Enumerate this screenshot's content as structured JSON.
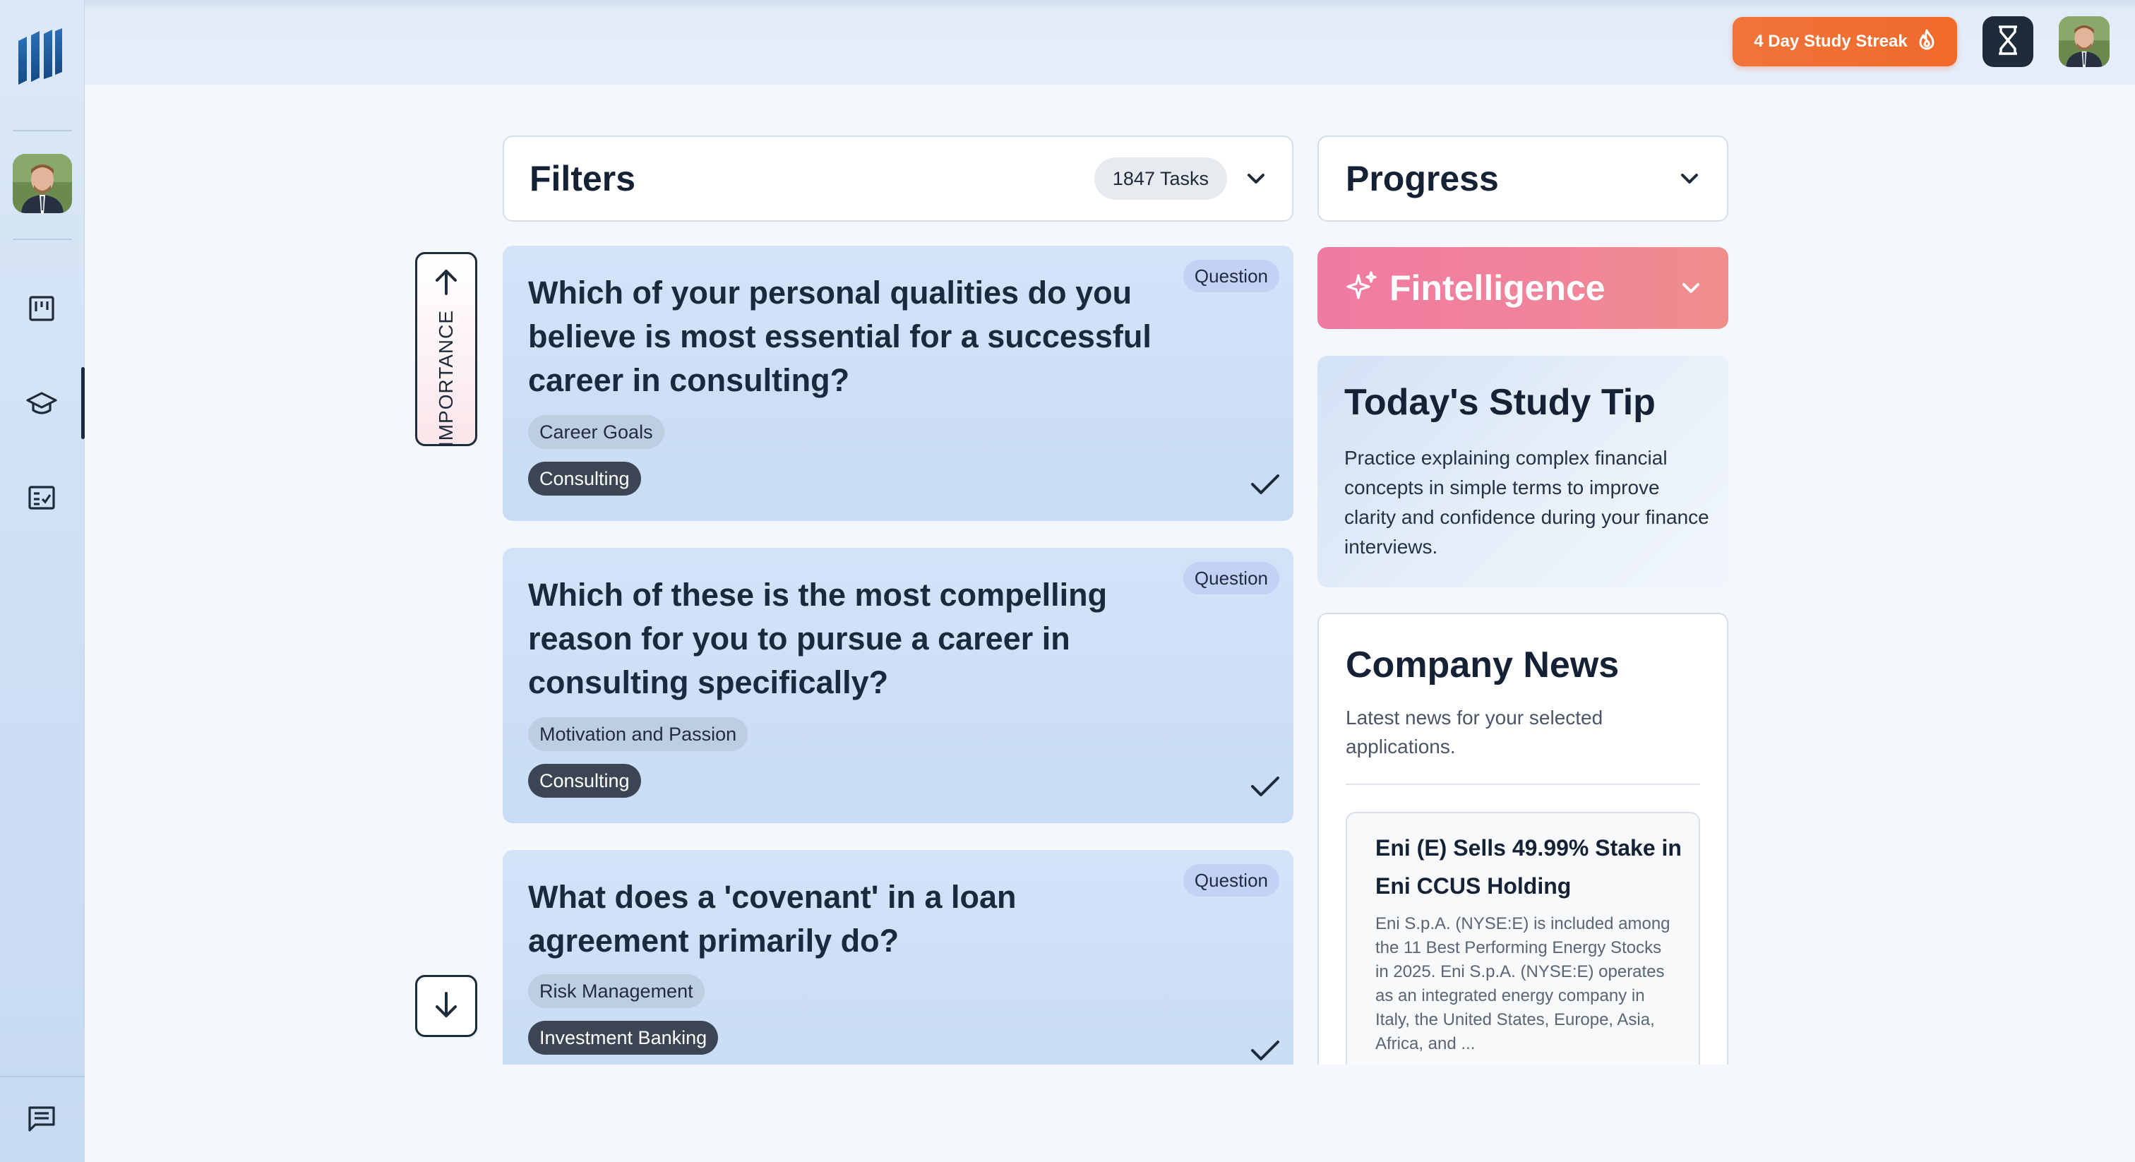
{
  "topbar": {
    "streak_label": "4 Day Study Streak"
  },
  "sidebar": {
    "items": [
      {
        "name": "board",
        "icon": "kanban-icon"
      },
      {
        "name": "learn",
        "icon": "graduation-cap-icon",
        "active": true
      },
      {
        "name": "tasks",
        "icon": "checklist-icon"
      },
      {
        "name": "chat",
        "icon": "message-icon"
      }
    ]
  },
  "filters": {
    "title": "Filters",
    "tasks_count": "1847 Tasks"
  },
  "importance": {
    "label": "IMPORTANCE"
  },
  "tasks": [
    {
      "question": "Which of your personal qualities do you believe is most essential for a successful career in consulting?",
      "badge": "Question",
      "tags": [
        {
          "label": "Career Goals",
          "style": "light"
        },
        {
          "label": "Consulting",
          "style": "dark"
        }
      ]
    },
    {
      "question": "Which of these is the most compelling reason for you to pursue a career in consulting specifically?",
      "badge": "Question",
      "tags": [
        {
          "label": "Motivation and Passion",
          "style": "light"
        },
        {
          "label": "Consulting",
          "style": "dark"
        }
      ]
    },
    {
      "question": "What does a 'covenant' in a loan agreement primarily do?",
      "badge": "Question",
      "tags": [
        {
          "label": "Risk Management",
          "style": "light"
        },
        {
          "label": "Investment Banking",
          "style": "dark"
        }
      ]
    }
  ],
  "progress": {
    "title": "Progress"
  },
  "fintelligence": {
    "title": "Fintelligence"
  },
  "study_tip": {
    "title": "Today's Study Tip",
    "body": "Practice explaining complex financial concepts in simple terms to improve clarity and confidence during your finance interviews."
  },
  "company_news": {
    "title": "Company News",
    "subtitle": "Latest news for your selected applications.",
    "items": [
      {
        "title": "Eni (E) Sells 49.99% Stake in Eni CCUS Holding",
        "body": "Eni S.p.A. (NYSE:E) is included among the 11 Best Performing Energy Stocks in 2025. Eni S.p.A. (NYSE:E) operates as an integrated energy company in Italy, the United States, Europe, Asia, Africa, and ..."
      }
    ]
  },
  "colors": {
    "streak": "#f06a2b",
    "fintelligence": "#f07aa2",
    "dark": "#1e2b3b",
    "card": "#cddff7"
  }
}
